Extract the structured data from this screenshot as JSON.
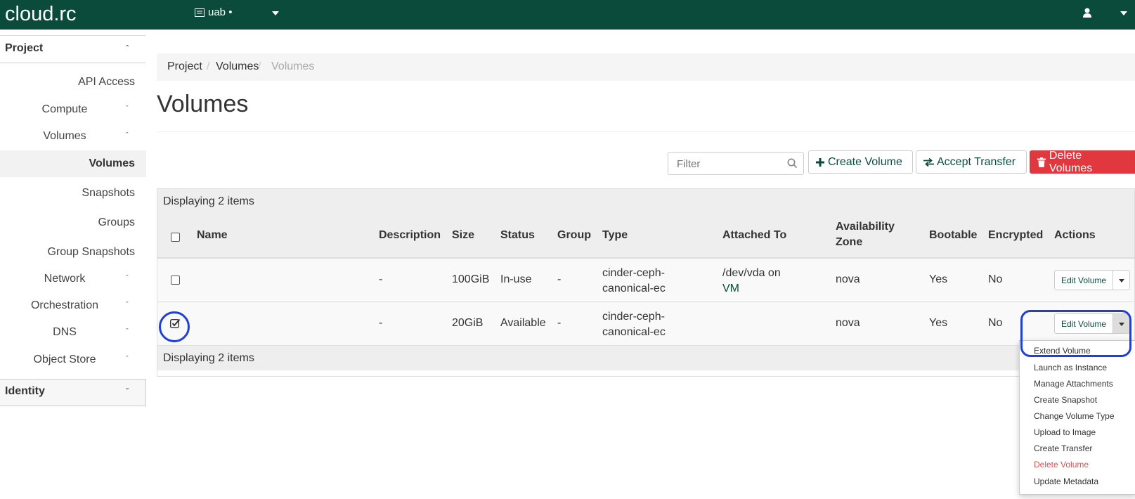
{
  "topbar": {
    "brand": "cloud.rc",
    "project": "uab •"
  },
  "sidebar": {
    "project": "Project",
    "api_access": "API Access",
    "compute": "Compute",
    "volumes_group": "Volumes",
    "volumes": "Volumes",
    "snapshots": "Snapshots",
    "groups": "Groups",
    "group_snapshots": "Group Snapshots",
    "network": "Network",
    "orchestration": "Orchestration",
    "dns": "DNS",
    "object_store": "Object Store",
    "identity": "Identity"
  },
  "breadcrumb": [
    "Project",
    "Volumes",
    "Volumes"
  ],
  "page_title": "Volumes",
  "toolbar": {
    "filter_placeholder": "Filter",
    "create": "Create Volume",
    "accept": "Accept Transfer",
    "delete": "Delete Volumes"
  },
  "table": {
    "summary": "Displaying 2 items",
    "headers": {
      "name": "Name",
      "description": "Description",
      "size": "Size",
      "status": "Status",
      "group": "Group",
      "type": "Type",
      "attached": "Attached To",
      "az1": "Availability",
      "az2": "Zone",
      "bootable": "Bootable",
      "encrypted": "Encrypted",
      "actions": "Actions"
    },
    "rows": [
      {
        "description": "-",
        "size": "100GiB",
        "status": "In-use",
        "group": "-",
        "type1": "cinder-ceph-",
        "type2": "canonical-ec",
        "attached1": "/dev/vda on",
        "attached2": "VM",
        "az": "nova",
        "bootable": "Yes",
        "encrypted": "No",
        "action": "Edit Volume"
      },
      {
        "description": "-",
        "size": "20GiB",
        "status": "Available",
        "group": "-",
        "type1": "cinder-ceph-",
        "type2": "canonical-ec",
        "attached1": "",
        "attached2": "",
        "az": "nova",
        "bootable": "Yes",
        "encrypted": "No",
        "action": "Edit Volume"
      }
    ]
  },
  "menu": [
    "Extend Volume",
    "Launch as Instance",
    "Manage Attachments",
    "Create Snapshot",
    "Change Volume Type",
    "Upload to Image",
    "Create Transfer",
    "Delete Volume",
    "Update Metadata"
  ],
  "colors": {
    "brand": "#0b4b3b",
    "danger": "#e0383e",
    "highlight": "#1f40d8"
  }
}
